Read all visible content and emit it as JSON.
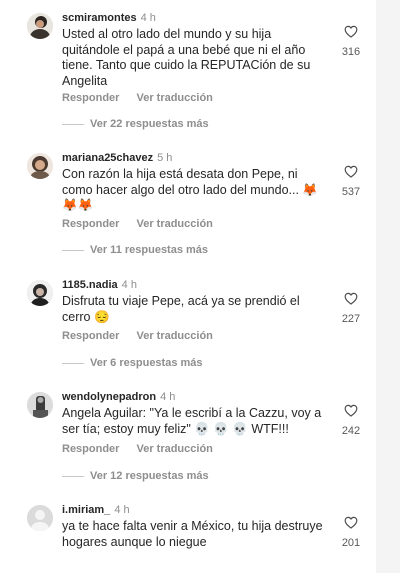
{
  "comments": [
    {
      "username": "scmiramontes",
      "time": "4 h",
      "text": "Usted al otro lado del mundo y su hija quitándole el papá a una bebé que ni el año tiene. Tanto que cuido la REPUTACión de su Angelita",
      "likes": "316",
      "reply": "Responder",
      "translate": "Ver traducción",
      "more_replies": "Ver 22 respuestas más"
    },
    {
      "username": "mariana25chavez",
      "time": "5 h",
      "text": "Con razón la hija está desata don Pepe, ni como hacer algo del otro lado del mundo... 🦊 🦊🦊",
      "likes": "537",
      "reply": "Responder",
      "translate": "Ver traducción",
      "more_replies": "Ver 11 respuestas más"
    },
    {
      "username": "1185.nadia",
      "time": "4 h",
      "text": "Disfruta tu viaje Pepe, acá ya se prendió el cerro 😔",
      "likes": "227",
      "reply": "Responder",
      "translate": "Ver traducción",
      "more_replies": "Ver 6 respuestas más"
    },
    {
      "username": "wendolynepadron",
      "time": "4 h",
      "text": "Angela Aguilar: \"Ya le escribí a la Cazzu, voy a ser tía; estoy muy feliz\" 💀 💀 💀 WTF!!!",
      "likes": "242",
      "reply": "Responder",
      "translate": "Ver traducción",
      "more_replies": "Ver 12 respuestas más"
    },
    {
      "username": "i.miriam_",
      "time": "4 h",
      "text": "ya te hace falta venir a México, tu hija destruye hogares aunque lo niegue",
      "likes": "201"
    }
  ]
}
